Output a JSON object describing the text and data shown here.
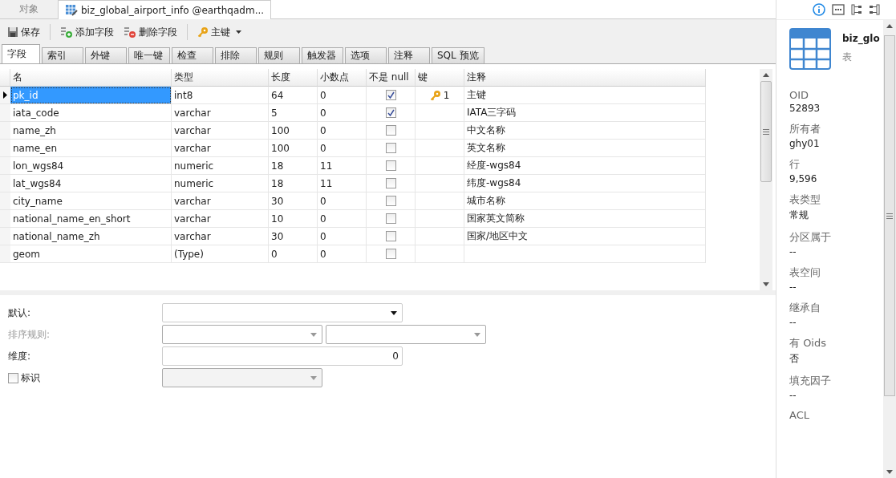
{
  "doc_tabs": [
    {
      "label": "对象",
      "kind": "plain",
      "selected": false
    },
    {
      "label": "biz_global_airport_info @earthqadm...",
      "kind": "table",
      "selected": true
    }
  ],
  "toolbar": [
    {
      "label": "保存",
      "kind": "save"
    },
    {
      "label": "添加字段",
      "kind": "add"
    },
    {
      "label": "删除字段",
      "kind": "delete"
    },
    {
      "label": "主键",
      "kind": "key"
    }
  ],
  "sub_tabs": [
    {
      "label": "字段",
      "selected": true
    },
    {
      "label": "索引",
      "selected": false
    },
    {
      "label": "外键",
      "selected": false
    },
    {
      "label": "唯一键",
      "selected": false
    },
    {
      "label": "检查",
      "selected": false
    },
    {
      "label": "排除",
      "selected": false
    },
    {
      "label": "规则",
      "selected": false
    },
    {
      "label": "触发器",
      "selected": false
    },
    {
      "label": "选项",
      "selected": false
    },
    {
      "label": "注释",
      "selected": false
    },
    {
      "label": "SQL 预览",
      "selected": false
    }
  ],
  "table": {
    "columns": [
      "名",
      "类型",
      "长度",
      "小数点",
      "不是 null",
      "键",
      "注释"
    ],
    "rows": [
      {
        "name": "pk_id",
        "type": "int8",
        "length": "64",
        "decimals": "0",
        "not_null": true,
        "key": "1",
        "comment": "主键",
        "selected": true
      },
      {
        "name": "iata_code",
        "type": "varchar",
        "length": "5",
        "decimals": "0",
        "not_null": true,
        "comment": "IATA三字码",
        "selected": false
      },
      {
        "name": "name_zh",
        "type": "varchar",
        "length": "100",
        "decimals": "0",
        "not_null": false,
        "comment": "中文名称",
        "selected": false
      },
      {
        "name": "name_en",
        "type": "varchar",
        "length": "100",
        "decimals": "0",
        "not_null": false,
        "comment": "英文名称",
        "selected": false
      },
      {
        "name": "lon_wgs84",
        "type": "numeric",
        "length": "18",
        "decimals": "11",
        "not_null": false,
        "comment": "经度-wgs84",
        "selected": false
      },
      {
        "name": "lat_wgs84",
        "type": "numeric",
        "length": "18",
        "decimals": "11",
        "not_null": false,
        "comment": "纬度-wgs84",
        "selected": false
      },
      {
        "name": "city_name",
        "type": "varchar",
        "length": "30",
        "decimals": "0",
        "not_null": false,
        "comment": "城市名称",
        "selected": false
      },
      {
        "name": "national_name_en_short",
        "type": "varchar",
        "length": "10",
        "decimals": "0",
        "not_null": false,
        "comment": "国家英文简称",
        "selected": false
      },
      {
        "name": "national_name_zh",
        "type": "varchar",
        "length": "30",
        "decimals": "0",
        "not_null": false,
        "comment": "国家/地区中文",
        "selected": false
      },
      {
        "name": "geom",
        "type": "(Type)",
        "length": "0",
        "decimals": "0",
        "not_null": false,
        "selected": false
      }
    ]
  },
  "form": [
    {
      "label": "默认:",
      "kind": "dropdown",
      "disabled": false
    },
    {
      "label": "排序规则:",
      "kind": "double_dropdown",
      "disabled": true
    },
    {
      "label": "维度:",
      "kind": "number",
      "value": "0",
      "disabled": false
    },
    {
      "label": "标识",
      "kind": "checkbox",
      "checked": false,
      "disabled": true
    }
  ],
  "side_panel": {
    "icons": [
      {
        "kind": "info",
        "selected": true
      },
      {
        "kind": "ddl",
        "selected": false
      },
      {
        "kind": "tree",
        "selected": false
      },
      {
        "kind": "diff",
        "selected": false
      }
    ],
    "title": "biz_glo",
    "subtitle": "表",
    "properties": [
      {
        "label": "OID",
        "value": "52893"
      },
      {
        "label": "所有者",
        "value": "ghy01"
      },
      {
        "label": "行",
        "value": "9,596"
      },
      {
        "label": "表类型",
        "value": "常规"
      },
      {
        "label": "分区属于",
        "value": "--"
      },
      {
        "label": "表空间",
        "value": "--"
      },
      {
        "label": "继承自",
        "value": "--"
      },
      {
        "label": "有 Oids",
        "value": "否"
      },
      {
        "label": "填充因子",
        "value": "--"
      },
      {
        "label": "ACL"
      }
    ]
  }
}
